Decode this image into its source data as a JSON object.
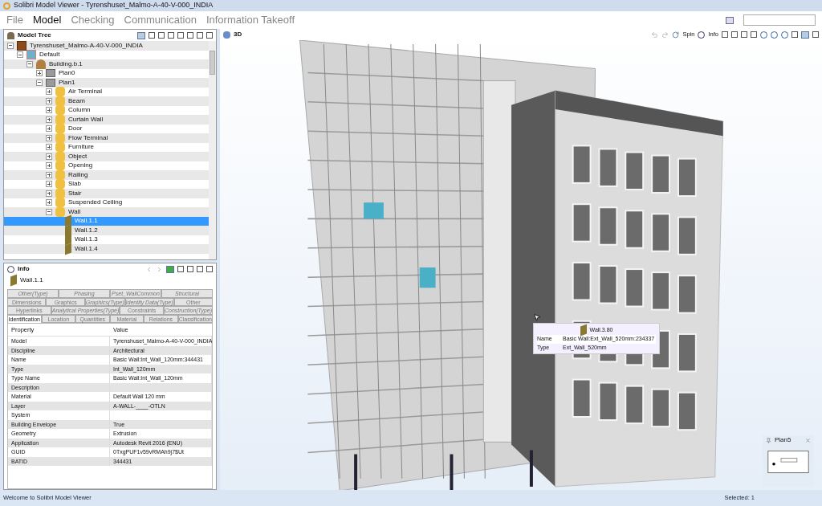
{
  "window": {
    "title": "Solibri Model Viewer - Tyrenshuset_Malmo-A-40-V-000_INDIA"
  },
  "menu": [
    {
      "label": "File",
      "selected": false
    },
    {
      "label": "Model",
      "selected": true
    },
    {
      "label": "Checking",
      "selected": false
    },
    {
      "label": "Communication",
      "selected": false
    },
    {
      "label": "Information Takeoff",
      "selected": false
    }
  ],
  "model_tree": {
    "title": "Model Tree",
    "items": [
      {
        "label": "Tyrenshuset_Malmo-A-40-V-000_INDIA",
        "kind": "model",
        "expanded": true,
        "selected": false,
        "children": [
          {
            "label": "Default",
            "kind": "layer",
            "expanded": true,
            "selected": false,
            "children": [
              {
                "label": "Building.b.1",
                "kind": "building",
                "expanded": true,
                "selected": false,
                "children": [
                  {
                    "label": "Plan0",
                    "kind": "plan",
                    "expanded": false,
                    "selected": false
                  },
                  {
                    "label": "Plan1",
                    "kind": "plan",
                    "expanded": true,
                    "selected": false,
                    "children": [
                      {
                        "label": "Air Terminal",
                        "kind": "folder",
                        "expanded": false,
                        "selected": false
                      },
                      {
                        "label": "Beam",
                        "kind": "folder",
                        "expanded": false,
                        "selected": false
                      },
                      {
                        "label": "Column",
                        "kind": "folder",
                        "expanded": false,
                        "selected": false
                      },
                      {
                        "label": "Curtain Wall",
                        "kind": "folder",
                        "expanded": false,
                        "selected": false
                      },
                      {
                        "label": "Door",
                        "kind": "folder",
                        "expanded": false,
                        "selected": false
                      },
                      {
                        "label": "Flow Terminal",
                        "kind": "folder",
                        "expanded": false,
                        "selected": false
                      },
                      {
                        "label": "Furniture",
                        "kind": "folder",
                        "expanded": false,
                        "selected": false
                      },
                      {
                        "label": "Object",
                        "kind": "folder",
                        "expanded": false,
                        "selected": false
                      },
                      {
                        "label": "Opening",
                        "kind": "folder",
                        "expanded": false,
                        "selected": false
                      },
                      {
                        "label": "Railing",
                        "kind": "folder",
                        "expanded": false,
                        "selected": false
                      },
                      {
                        "label": "Slab",
                        "kind": "folder",
                        "expanded": false,
                        "selected": false
                      },
                      {
                        "label": "Stair",
                        "kind": "folder",
                        "expanded": false,
                        "selected": false
                      },
                      {
                        "label": "Suspended Ceiling",
                        "kind": "folder",
                        "expanded": false,
                        "selected": false
                      },
                      {
                        "label": "Wall",
                        "kind": "folder",
                        "expanded": true,
                        "selected": false,
                        "children": [
                          {
                            "label": "Wall.1.1",
                            "kind": "wall",
                            "selected": true
                          },
                          {
                            "label": "Wall.1.2",
                            "kind": "wall",
                            "selected": false
                          },
                          {
                            "label": "Wall.1.3",
                            "kind": "wall",
                            "selected": false
                          },
                          {
                            "label": "Wall.1.4",
                            "kind": "wall",
                            "selected": false
                          }
                        ]
                      }
                    ]
                  }
                ]
              }
            ]
          }
        ]
      }
    ]
  },
  "info": {
    "title": "Info",
    "object": "Wall.1.1",
    "tab_rows": [
      [
        {
          "label": "Other(Type)",
          "italic": true,
          "selected": false
        },
        {
          "label": "Phasing",
          "italic": true,
          "selected": false
        },
        {
          "label": "Pset_WallCommon",
          "italic": true,
          "selected": false
        },
        {
          "label": "Structural",
          "italic": true,
          "selected": false
        }
      ],
      [
        {
          "label": "Dimensions",
          "italic": false,
          "selected": false
        },
        {
          "label": "Graphics",
          "italic": false,
          "selected": false
        },
        {
          "label": "Graphics(Type)",
          "italic": true,
          "selected": false
        },
        {
          "label": "Identity Data(Type)",
          "italic": true,
          "selected": false
        },
        {
          "label": "Other",
          "italic": false,
          "selected": false
        }
      ],
      [
        {
          "label": "Hyperlinks",
          "italic": false,
          "selected": false
        },
        {
          "label": "Analytical Properties(Type)",
          "italic": true,
          "selected": false
        },
        {
          "label": "Constraints",
          "italic": false,
          "selected": false
        },
        {
          "label": "Construction(Type)",
          "italic": true,
          "selected": false
        }
      ],
      [
        {
          "label": "Identification",
          "italic": false,
          "selected": true
        },
        {
          "label": "Location",
          "italic": false,
          "selected": false
        },
        {
          "label": "Quantities",
          "italic": false,
          "selected": false
        },
        {
          "label": "Material",
          "italic": false,
          "selected": false
        },
        {
          "label": "Relations",
          "italic": false,
          "selected": false
        },
        {
          "label": "Classification",
          "italic": false,
          "selected": false
        }
      ]
    ],
    "columns": [
      "Property",
      "Value"
    ],
    "rows": [
      [
        "Model",
        "Tyrenshuset_Malmo-A-40-V-000_INDIA"
      ],
      [
        "Discipline",
        "Architectural"
      ],
      [
        "Name",
        "Basic Wall:Int_Wall_120mm:344431"
      ],
      [
        "Type",
        "Int_Wall_120mm"
      ],
      [
        "Type Name",
        "Basic Wall:Int_Wall_120mm"
      ],
      [
        "Description",
        ""
      ],
      [
        "Material",
        "Default Wall 120 mm"
      ],
      [
        "Layer",
        "A-WALL-____-OTLN"
      ],
      [
        "System",
        ""
      ],
      [
        "Building Envelope",
        "True"
      ],
      [
        "Geometry",
        "Extrusion"
      ],
      [
        "Application",
        "Autodesk Revit 2016 (ENU)"
      ],
      [
        "GUID",
        "0TxgPUF1v59vRMAh9j7$Ut"
      ],
      [
        "BATID",
        "344431"
      ]
    ]
  },
  "viewer": {
    "title": "3D",
    "toolbar": [
      "Spin",
      "Info"
    ],
    "tooltip": {
      "title": "Wall.3.80",
      "rows": [
        [
          "Name",
          "Basic Wall:Ext_Wall_520mm:234337"
        ],
        [
          "Type",
          "Ext_Wall_520mm"
        ]
      ]
    },
    "minimap": {
      "title": "Plan5"
    }
  },
  "status_bar": {
    "message": "Welcome to Solibri Model Viewer",
    "selection": "Selected: 1"
  }
}
